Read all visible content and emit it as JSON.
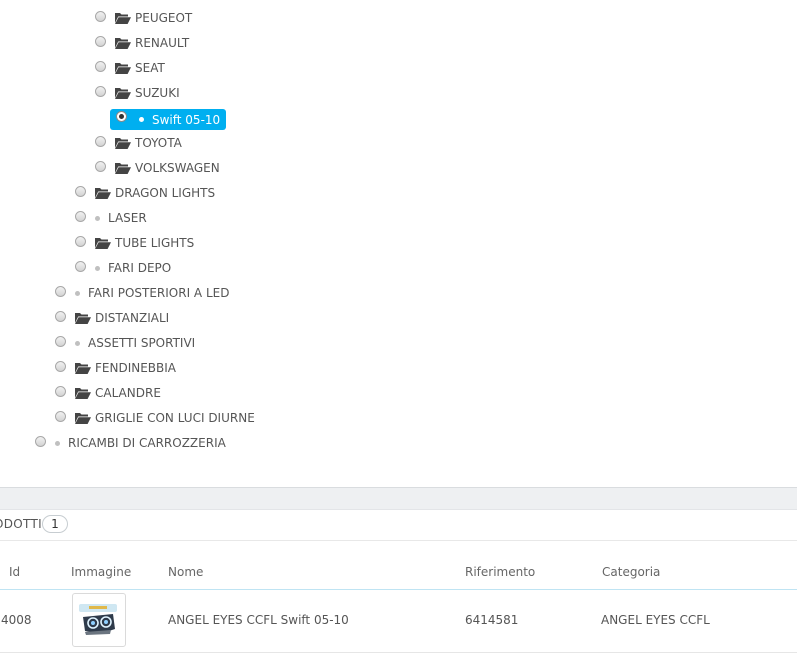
{
  "tree": {
    "items": [
      {
        "label": "PEUGEOT",
        "type": "folder"
      },
      {
        "label": "RENAULT",
        "type": "folder"
      },
      {
        "label": "SEAT",
        "type": "folder"
      },
      {
        "label": "SUZUKI",
        "type": "folder"
      },
      {
        "label": "Swift 05-10",
        "type": "leaf",
        "selected": true
      },
      {
        "label": "TOYOTA",
        "type": "folder"
      },
      {
        "label": "VOLKSWAGEN",
        "type": "folder"
      },
      {
        "label": "DRAGON LIGHTS",
        "type": "folder"
      },
      {
        "label": "LASER",
        "type": "leaf"
      },
      {
        "label": "TUBE LIGHTS",
        "type": "folder"
      },
      {
        "label": "FARI DEPO",
        "type": "leaf"
      },
      {
        "label": "FARI POSTERIORI A LED",
        "type": "leaf"
      },
      {
        "label": "DISTANZIALI",
        "type": "folder"
      },
      {
        "label": "ASSETTI SPORTIVI",
        "type": "leaf"
      },
      {
        "label": "FENDINEBBIA",
        "type": "folder"
      },
      {
        "label": "CALANDRE",
        "type": "folder"
      },
      {
        "label": "GRIGLIE CON LUCI DIURNE",
        "type": "folder"
      },
      {
        "label": "RICAMBI DI CARROZZERIA",
        "type": "leaf"
      }
    ]
  },
  "products_panel": {
    "title": "ODOTTI",
    "count": "1"
  },
  "table": {
    "columns": [
      "Id",
      "Immagine",
      "Nome",
      "Riferimento",
      "Categoria"
    ],
    "rows": [
      {
        "id": "4008",
        "name": "ANGEL EYES CCFL Swift 05-10",
        "reference": "6414581",
        "category": "ANGEL EYES CCFL"
      }
    ]
  },
  "colors": {
    "selected_bg": "#00aff0",
    "text": "#555555",
    "divider": "#eef0f2"
  }
}
